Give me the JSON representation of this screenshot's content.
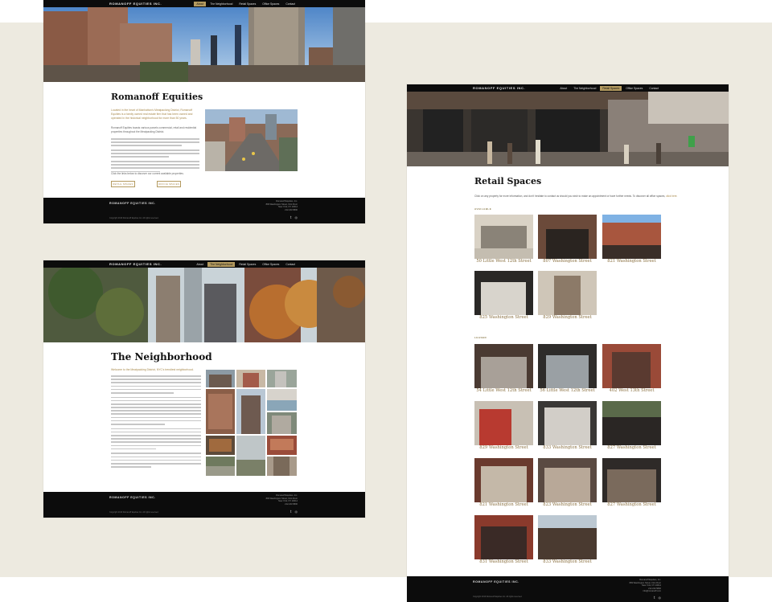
{
  "brand": "ROMANOFF EQUITIES INC.",
  "nav": {
    "about": "About",
    "neighborhood": "The Neighborhood",
    "retail": "Retail Spaces",
    "office": "Office Spaces",
    "contact": "Contact"
  },
  "home": {
    "title": "Romanoff Equities",
    "lead": "Located in the heart of Manhattan's Meatpacking District, Romanoff Equities is a family owned real estate firm that has been owned and operated in the historical neighborhood for more than 50 years.",
    "p1": "Romanoff Equities boasts various parcels commercial, retail and residential properties throughout the Meatpacking District.",
    "p4": "Click the links below to discover our current available properties.",
    "btn_retail": "RETAIL SPACES",
    "btn_office": "OFFICE SPACES"
  },
  "neighborhood": {
    "title": "The Neighborhood",
    "lead": "Welcome to the Meatpacking District, NYC's trendiest neighborhood."
  },
  "retail": {
    "title": "Retail Spaces",
    "intro_text": "Click on any property for more information, and don't hesitate to contact us should you wish to make an appointment or have further needs. To discover all office spaces,",
    "intro_link": "click here.",
    "available_heading": "AVAILABLE",
    "leased_heading": "LEASED",
    "available": [
      "50 Little West 12th Street",
      "807 Washington Street",
      "821 Washington Street",
      "825 Washington Street",
      "829 Washington Street"
    ],
    "leased": [
      "54 Little West 12th Street",
      "56 Little West 12th Street",
      "402 West 13th Street",
      "829 Washington Street",
      "833 Washington Street",
      "827 Washington Street",
      "821 Washington Street",
      "823 Washington Street",
      "827 Washington Street",
      "831 Washington Street",
      "833 Washington Street"
    ]
  },
  "footer": {
    "company": "Romanoff Equities, Inc.",
    "address1": "809 Washington Street, First Floor",
    "address2": "New York, NY 10014",
    "phone": "212.243.5800",
    "email": "info@romanoff.com",
    "copyright": "Copyright 2019 Romanoff Equities Inc. All rights reserved."
  }
}
